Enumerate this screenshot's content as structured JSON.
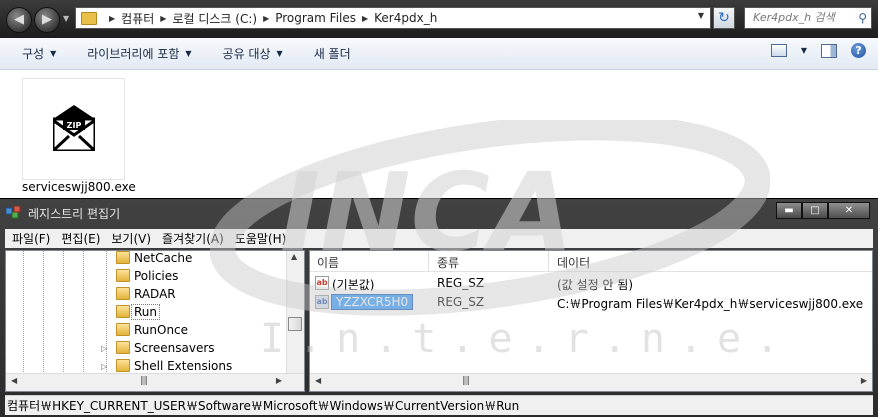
{
  "explorer": {
    "breadcrumb": [
      "컴퓨터",
      "로컬 디스크 (C:)",
      "Program Files",
      "Ker4pdx_h"
    ],
    "search_placeholder": "Ker4pdx_h 검색",
    "commands": [
      "구성",
      "라이브러리에 포함",
      "공유 대상",
      "새 폴더"
    ],
    "file": {
      "name": "serviceswjj800.exe",
      "icon_text": "ZIP",
      "icon": "zip-envelope-icon"
    }
  },
  "regedit": {
    "title": "레지스트리 편집기",
    "menu": [
      "파일(F)",
      "편집(E)",
      "보기(V)",
      "즐겨찾기(A)",
      "도움말(H)"
    ],
    "tree": [
      {
        "label": "NetCache",
        "expandable": false,
        "selected": false
      },
      {
        "label": "Policies",
        "expandable": false,
        "selected": false
      },
      {
        "label": "RADAR",
        "expandable": false,
        "selected": false
      },
      {
        "label": "Run",
        "expandable": false,
        "selected": true
      },
      {
        "label": "RunOnce",
        "expandable": false,
        "selected": false
      },
      {
        "label": "Screensavers",
        "expandable": true,
        "selected": false
      },
      {
        "label": "Shell Extensions",
        "expandable": true,
        "selected": false
      }
    ],
    "columns": {
      "name": "이름",
      "type": "종류",
      "data": "데이터"
    },
    "values": [
      {
        "name": "(기본값)",
        "type": "REG_SZ",
        "data": "(값 설정 안 됨)",
        "editing": false
      },
      {
        "name": "YZZXCR5H0",
        "type": "REG_SZ",
        "data": "C:￦Program Files￦Ker4pdx_h￦serviceswjj800.exe",
        "editing": true
      }
    ],
    "status_path": "컴퓨터￦HKEY_CURRENT_USER￦Software￦Microsoft￦Windows￦CurrentVersion￦Run"
  },
  "watermark": {
    "logo": "INCA",
    "subtext": "I.n.t.e.r.n.e.t"
  },
  "colors": {
    "selection": "#3399ff",
    "window_dark": "#2b2b2b",
    "folder": "#e3b43a"
  }
}
